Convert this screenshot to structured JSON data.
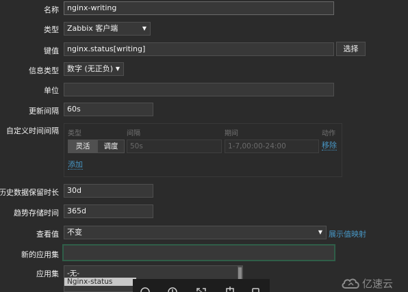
{
  "form": {
    "name_label": "名称",
    "name_value": "nginx-writing",
    "type_label": "类型",
    "type_value": "Zabbix 客户端",
    "key_label": "键值",
    "key_value": "nginx.status[writing]",
    "key_select_button": "选择",
    "info_type_label": "信息类型",
    "info_type_value": "数字 (无正负)",
    "unit_label": "单位",
    "unit_value": "",
    "update_interval_label": "更新间隔",
    "update_interval_value": "60s",
    "custom_interval_label": "自定义时间间隔",
    "history_label": "历史数据保留时长",
    "history_value": "30d",
    "trend_label": "趋势存储时间",
    "trend_value": "365d",
    "show_value_label": "查看值",
    "show_value_value": "不变",
    "show_value_mapping_link": "展示值映射",
    "new_app_label": "新的应用集",
    "new_app_value": "",
    "app_label": "应用集"
  },
  "custom_intervals": {
    "headers": {
      "type": "类型",
      "interval": "间隔",
      "period": "期间",
      "action": "动作"
    },
    "row": {
      "mode_flexible": "灵活",
      "mode_scheduling": "调度",
      "interval_placeholder": "50s",
      "period_placeholder": "1-7,00:00-24:00",
      "remove_link": "移除"
    },
    "add_link": "添加"
  },
  "applications": {
    "options": [
      "-无-",
      "Nginx-status"
    ],
    "selected_index": 1
  },
  "toolbar": {
    "icons": [
      "zoom-out-icon",
      "zoom-in-icon",
      "fullscreen-icon",
      "rotate-icon",
      "window-icon"
    ]
  },
  "watermark": {
    "text": "亿速云"
  },
  "colors": {
    "background": "#2b2b2b",
    "input_bg": "#383838",
    "link": "#4796c4",
    "focus_border": "#2f5e48"
  }
}
